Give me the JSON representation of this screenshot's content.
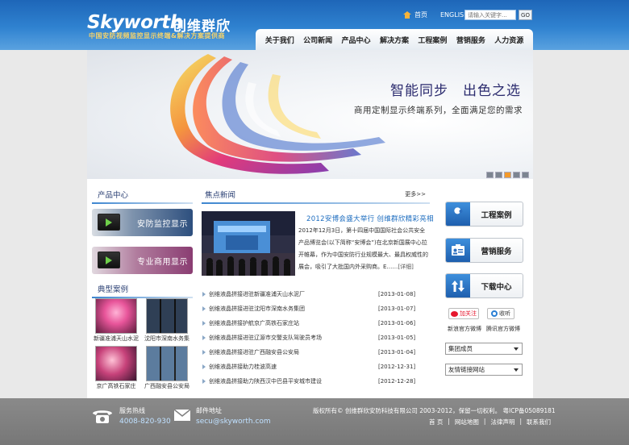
{
  "header": {
    "logo_text": "Skyworth",
    "logo_cn": "创维群欣",
    "slogan": "中国安防视频监控显示终端&解决方案提供商",
    "home_link": "首页",
    "english_link": "ENGLISH",
    "search_placeholder": "请输入关键字...",
    "go_label": "GO"
  },
  "nav": [
    "关于我们",
    "公司新闻",
    "产品中心",
    "解决方案",
    "工程案例",
    "营销服务",
    "人力资源"
  ],
  "banner": {
    "title": "智能同步　出色之选",
    "subtitle": "商用定制显示终端系列，全面满足您的需求",
    "dot_count": 5,
    "active_dot": 2
  },
  "products": {
    "title": "产品中心",
    "items": [
      "安防监控显示",
      "专业商用显示"
    ]
  },
  "cases": {
    "title": "典型案例",
    "items": [
      "新疆准浦天山水泥",
      "沈阳市深南水务集",
      "京广高铁石家庄",
      "广西融安县公安局"
    ]
  },
  "news": {
    "title": "焦点新闻",
    "more": "更多>>",
    "headline": "2012安博会盛大举行 创维群欣精彩亮相",
    "body": "2012年12月3日，第十四届中国国际社会公共安全产品博览会(以下简称“安博会”)在北京新国展中心拉开帷幕，作为中国安防行业规模最大、最具权威性的展会，吸引了大批国内外采购商。E……",
    "detail_link": "[详细]",
    "items": [
      {
        "title": "创维液晶拼接进驻新疆准浦天山水泥厂",
        "date": "[2013-01-08]"
      },
      {
        "title": "创维液晶拼接进驻沈阳市深南水务集团",
        "date": "[2013-01-07]"
      },
      {
        "title": "创维液晶拼接护航京广高铁石家庄站",
        "date": "[2013-01-06]"
      },
      {
        "title": "创维液晶拼接进驻辽源市交警支队驾驶员考场",
        "date": "[2013-01-05]"
      },
      {
        "title": "创维液晶拼接进驻广西融安县公安局",
        "date": "[2013-01-04]"
      },
      {
        "title": "创维液晶拼接助力桂波高速",
        "date": "[2012-12-31]"
      },
      {
        "title": "创维液晶拼接助力陕西汉中巴县平安城市建设",
        "date": "[2012-12-28]"
      }
    ]
  },
  "quick_links": [
    "工程案例",
    "营销服务",
    "下载中心"
  ],
  "weibo": {
    "sina_btn": "加关注",
    "tencent_btn": "收听",
    "sina_caption": "新浪官方微博",
    "tencent_caption": "腾讯官方微博"
  },
  "selects": [
    "集团成员",
    "友情链接网站"
  ],
  "footer": {
    "hotline_label": "服务热线",
    "hotline": "4008-820-930",
    "mail_label": "邮件地址",
    "mail": "secu@skyworth.com",
    "copyright": "版权所有© 创维群欣安防科技有限公司 2003-2012，保留一切权利。 粤ICP备05089181",
    "links": [
      "首 页",
      "|",
      "网站地图",
      "|",
      "法律声明",
      "|",
      "联系我们"
    ]
  },
  "colors": {
    "header_blue": "#2f82d0",
    "accent_orange": "#f39a2b",
    "headline_blue": "#1c6cbf",
    "footer_gray": "#808080"
  }
}
